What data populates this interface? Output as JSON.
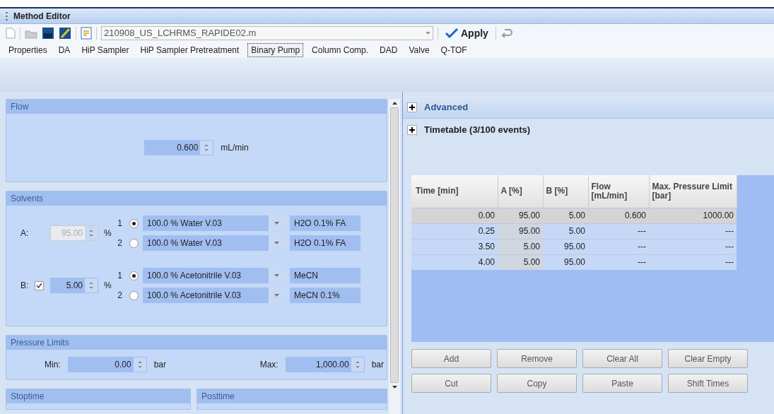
{
  "window": {
    "title": "Method Editor"
  },
  "toolbar": {
    "method_file": "210908_US_LCHRMS_RAPIDE02.m",
    "apply": "Apply"
  },
  "tabs": [
    {
      "label": "Properties",
      "selected": false
    },
    {
      "label": "DA",
      "selected": false
    },
    {
      "label": "HiP Sampler",
      "selected": false
    },
    {
      "label": "HiP Sampler Pretreatment",
      "selected": false
    },
    {
      "label": "Binary Pump",
      "selected": true
    },
    {
      "label": "Column Comp.",
      "selected": false
    },
    {
      "label": "DAD",
      "selected": false
    },
    {
      "label": "Valve",
      "selected": false
    },
    {
      "label": "Q-TOF",
      "selected": false
    }
  ],
  "flow": {
    "title": "Flow",
    "value": "0.600",
    "unit": "mL/min"
  },
  "solvents": {
    "title": "Solvents",
    "unit": "%",
    "channels": [
      {
        "label": "A:",
        "enabled_checkbox": false,
        "value": "95.00",
        "disabled": true,
        "options": [
          {
            "number": "1",
            "selected": true,
            "solvent": "100.0 % Water V.03",
            "name": "H2O 0.1% FA"
          },
          {
            "number": "2",
            "selected": false,
            "solvent": "100.0 % Water V.03",
            "name": "H2O 0.1% FA"
          }
        ]
      },
      {
        "label": "B:",
        "enabled_checkbox": true,
        "checked": true,
        "value": "5.00",
        "disabled": false,
        "options": [
          {
            "number": "1",
            "selected": true,
            "solvent": "100.0 % Acetonitrile V.03",
            "name": "MeCN"
          },
          {
            "number": "2",
            "selected": false,
            "solvent": "100.0 % Acetonitrile V.03",
            "name": "MeCN 0.1%"
          }
        ]
      }
    ]
  },
  "pressure_limits": {
    "title": "Pressure Limits",
    "min_label": "Min:",
    "min": "0.00",
    "min_unit": "bar",
    "max_label": "Max:",
    "max": "1,000.00",
    "max_unit": "bar"
  },
  "stoptime": {
    "title": "Stoptime"
  },
  "posttime": {
    "title": "Posttime"
  },
  "sections": [
    {
      "title": "Advanced",
      "expanded": false
    },
    {
      "title": "Timetable (3/100 events)",
      "expanded": false
    }
  ],
  "timetable": {
    "columns": [
      "Time [min]",
      "A [%]",
      "B [%]",
      "Flow [mL/min]",
      "Max. Pressure Limit [bar]"
    ],
    "rows": [
      {
        "selected": true,
        "cells": [
          "0.00",
          "95.00",
          "5.00",
          "0.600",
          "1000.00"
        ]
      },
      {
        "selected": false,
        "cells": [
          "0.25",
          "95.00",
          "5.00",
          "---",
          "---"
        ]
      },
      {
        "selected": false,
        "cells": [
          "3.50",
          "5.00",
          "95.00",
          "---",
          "---"
        ]
      },
      {
        "selected": false,
        "cells": [
          "4.00",
          "5.00",
          "95.00",
          "---",
          "---"
        ]
      }
    ]
  },
  "buttons": [
    "Add",
    "Remove",
    "Clear All",
    "Clear Empty",
    "Cut",
    "Copy",
    "Paste",
    "Shift Times"
  ]
}
